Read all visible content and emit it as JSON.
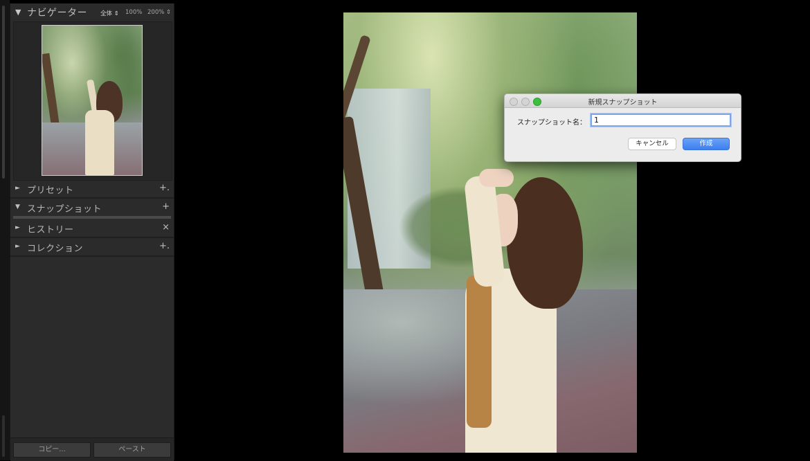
{
  "panel": {
    "navigator": {
      "title": "ナビゲーター",
      "zoom_options": [
        "全体 ⇕",
        "100%",
        "200% ⇕"
      ],
      "selected_zoom": "全体"
    },
    "sections": [
      {
        "label": "プリセット",
        "state": "collapsed",
        "action": "+."
      },
      {
        "label": "スナップショット",
        "state": "expanded",
        "action": "+"
      },
      {
        "label": "ヒストリー",
        "state": "collapsed",
        "action": "×"
      },
      {
        "label": "コレクション",
        "state": "collapsed",
        "action": "+."
      }
    ],
    "bottom_buttons": {
      "copy": "コピー...",
      "paste": "ペースト"
    }
  },
  "dialog": {
    "title": "新規スナップショット",
    "field_label": "スナップショット名：",
    "field_value": "1",
    "cancel": "キャンセル",
    "create": "作成",
    "accent_color": "#3d7ff0"
  },
  "icons": {
    "expanded": "▼",
    "collapsed": "►"
  }
}
